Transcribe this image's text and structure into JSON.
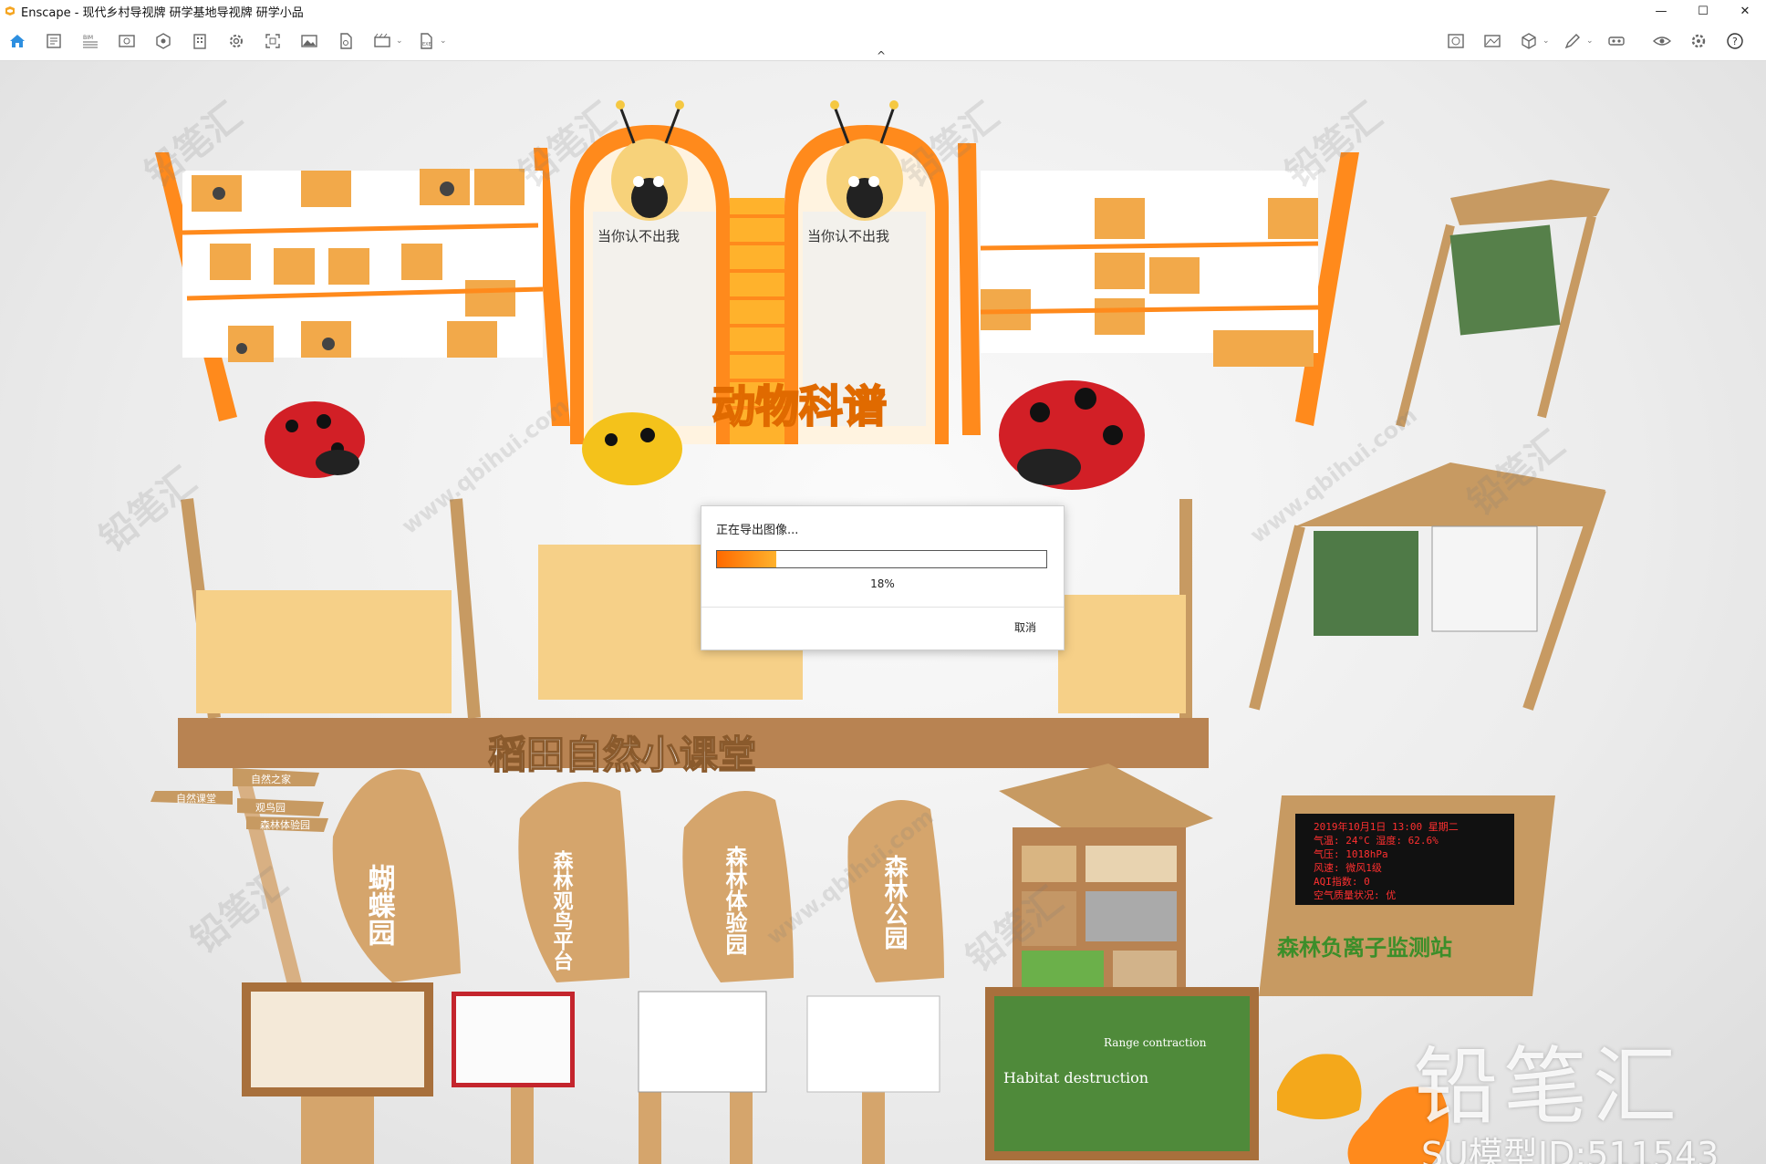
{
  "window": {
    "app_name": "Enscape",
    "title": "Enscape - 现代乡村导视牌 研学基地导视牌 研学小品",
    "controls": [
      "—",
      "☐",
      "✕"
    ]
  },
  "toolbar": {
    "left_icons": [
      "home-icon",
      "properties-icon",
      "bim-icon",
      "view-icon",
      "asset-library-icon",
      "building-icon",
      "settings-gear-icon",
      "screenshot-icon",
      "image-icon",
      "file-export-icon",
      "video-icon",
      "exe-export-icon"
    ],
    "right_icons": [
      "web-standalone-icon",
      "panorama-icon",
      "box-icon",
      "pen-icon",
      "vr-headset-icon",
      "eye-icon",
      "gear-icon",
      "help-icon"
    ],
    "collapse_arrow": "^"
  },
  "scene": {
    "sign_animal_scroll": "动物科谱",
    "sign_paddy_class": "稻田自然小课堂",
    "wood_sign_1": "蝴蝶园",
    "wood_sign_2": "森林观鸟平台",
    "wood_sign_3": "森林体验园",
    "wood_sign_4": "森林公园",
    "monitor_title": "森林负离子监测站",
    "monitor_line_1": "2019年10月1日 13:00 星期二",
    "monitor_line_2": "气温: 24°C   湿度: 62.6%",
    "monitor_line_3": "气压: 1018hPa",
    "monitor_line_4": "风速: 微风1级",
    "monitor_line_5": "AQI指数: 0",
    "monitor_line_6": "空气质量状况: 优",
    "direction_1": "自然之家",
    "direction_2": "自然课堂",
    "direction_3": "观鸟园",
    "direction_4": "森林体验园",
    "bee_board_heading": "当你认不出我",
    "board_habitat": "Habitat destruction",
    "board_range": "Range contraction"
  },
  "dialog": {
    "title": "正在导出图像...",
    "progress": 0.18,
    "percent_text": "18%",
    "cancel_label": "取消"
  },
  "watermark": {
    "brand": "铅笔汇",
    "model_id": "SU模型ID:511543",
    "site_text": "www.qbihui.com",
    "tile_text": "铅笔汇"
  },
  "colors": {
    "accent_orange": "#ff8a1c",
    "toolbar_home": "#2d8fe0",
    "wood": "#c79a62"
  }
}
